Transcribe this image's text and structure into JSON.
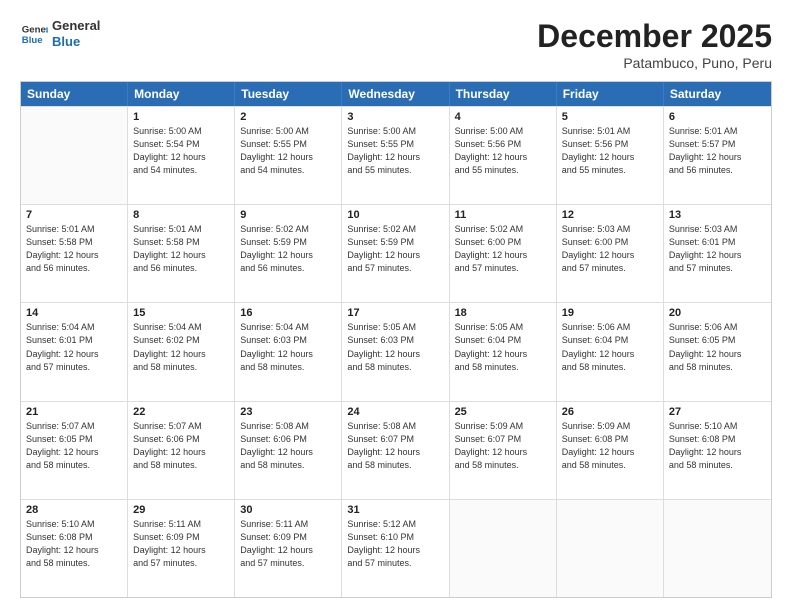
{
  "logo": {
    "line1": "General",
    "line2": "Blue"
  },
  "title": "December 2025",
  "subtitle": "Patambuco, Puno, Peru",
  "header_days": [
    "Sunday",
    "Monday",
    "Tuesday",
    "Wednesday",
    "Thursday",
    "Friday",
    "Saturday"
  ],
  "weeks": [
    [
      {
        "day": "",
        "info": ""
      },
      {
        "day": "1",
        "info": "Sunrise: 5:00 AM\nSunset: 5:54 PM\nDaylight: 12 hours\nand 54 minutes."
      },
      {
        "day": "2",
        "info": "Sunrise: 5:00 AM\nSunset: 5:55 PM\nDaylight: 12 hours\nand 54 minutes."
      },
      {
        "day": "3",
        "info": "Sunrise: 5:00 AM\nSunset: 5:55 PM\nDaylight: 12 hours\nand 55 minutes."
      },
      {
        "day": "4",
        "info": "Sunrise: 5:00 AM\nSunset: 5:56 PM\nDaylight: 12 hours\nand 55 minutes."
      },
      {
        "day": "5",
        "info": "Sunrise: 5:01 AM\nSunset: 5:56 PM\nDaylight: 12 hours\nand 55 minutes."
      },
      {
        "day": "6",
        "info": "Sunrise: 5:01 AM\nSunset: 5:57 PM\nDaylight: 12 hours\nand 56 minutes."
      }
    ],
    [
      {
        "day": "7",
        "info": "Sunrise: 5:01 AM\nSunset: 5:58 PM\nDaylight: 12 hours\nand 56 minutes."
      },
      {
        "day": "8",
        "info": "Sunrise: 5:01 AM\nSunset: 5:58 PM\nDaylight: 12 hours\nand 56 minutes."
      },
      {
        "day": "9",
        "info": "Sunrise: 5:02 AM\nSunset: 5:59 PM\nDaylight: 12 hours\nand 56 minutes."
      },
      {
        "day": "10",
        "info": "Sunrise: 5:02 AM\nSunset: 5:59 PM\nDaylight: 12 hours\nand 57 minutes."
      },
      {
        "day": "11",
        "info": "Sunrise: 5:02 AM\nSunset: 6:00 PM\nDaylight: 12 hours\nand 57 minutes."
      },
      {
        "day": "12",
        "info": "Sunrise: 5:03 AM\nSunset: 6:00 PM\nDaylight: 12 hours\nand 57 minutes."
      },
      {
        "day": "13",
        "info": "Sunrise: 5:03 AM\nSunset: 6:01 PM\nDaylight: 12 hours\nand 57 minutes."
      }
    ],
    [
      {
        "day": "14",
        "info": "Sunrise: 5:04 AM\nSunset: 6:01 PM\nDaylight: 12 hours\nand 57 minutes."
      },
      {
        "day": "15",
        "info": "Sunrise: 5:04 AM\nSunset: 6:02 PM\nDaylight: 12 hours\nand 58 minutes."
      },
      {
        "day": "16",
        "info": "Sunrise: 5:04 AM\nSunset: 6:03 PM\nDaylight: 12 hours\nand 58 minutes."
      },
      {
        "day": "17",
        "info": "Sunrise: 5:05 AM\nSunset: 6:03 PM\nDaylight: 12 hours\nand 58 minutes."
      },
      {
        "day": "18",
        "info": "Sunrise: 5:05 AM\nSunset: 6:04 PM\nDaylight: 12 hours\nand 58 minutes."
      },
      {
        "day": "19",
        "info": "Sunrise: 5:06 AM\nSunset: 6:04 PM\nDaylight: 12 hours\nand 58 minutes."
      },
      {
        "day": "20",
        "info": "Sunrise: 5:06 AM\nSunset: 6:05 PM\nDaylight: 12 hours\nand 58 minutes."
      }
    ],
    [
      {
        "day": "21",
        "info": "Sunrise: 5:07 AM\nSunset: 6:05 PM\nDaylight: 12 hours\nand 58 minutes."
      },
      {
        "day": "22",
        "info": "Sunrise: 5:07 AM\nSunset: 6:06 PM\nDaylight: 12 hours\nand 58 minutes."
      },
      {
        "day": "23",
        "info": "Sunrise: 5:08 AM\nSunset: 6:06 PM\nDaylight: 12 hours\nand 58 minutes."
      },
      {
        "day": "24",
        "info": "Sunrise: 5:08 AM\nSunset: 6:07 PM\nDaylight: 12 hours\nand 58 minutes."
      },
      {
        "day": "25",
        "info": "Sunrise: 5:09 AM\nSunset: 6:07 PM\nDaylight: 12 hours\nand 58 minutes."
      },
      {
        "day": "26",
        "info": "Sunrise: 5:09 AM\nSunset: 6:08 PM\nDaylight: 12 hours\nand 58 minutes."
      },
      {
        "day": "27",
        "info": "Sunrise: 5:10 AM\nSunset: 6:08 PM\nDaylight: 12 hours\nand 58 minutes."
      }
    ],
    [
      {
        "day": "28",
        "info": "Sunrise: 5:10 AM\nSunset: 6:08 PM\nDaylight: 12 hours\nand 58 minutes."
      },
      {
        "day": "29",
        "info": "Sunrise: 5:11 AM\nSunset: 6:09 PM\nDaylight: 12 hours\nand 57 minutes."
      },
      {
        "day": "30",
        "info": "Sunrise: 5:11 AM\nSunset: 6:09 PM\nDaylight: 12 hours\nand 57 minutes."
      },
      {
        "day": "31",
        "info": "Sunrise: 5:12 AM\nSunset: 6:10 PM\nDaylight: 12 hours\nand 57 minutes."
      },
      {
        "day": "",
        "info": ""
      },
      {
        "day": "",
        "info": ""
      },
      {
        "day": "",
        "info": ""
      }
    ]
  ]
}
